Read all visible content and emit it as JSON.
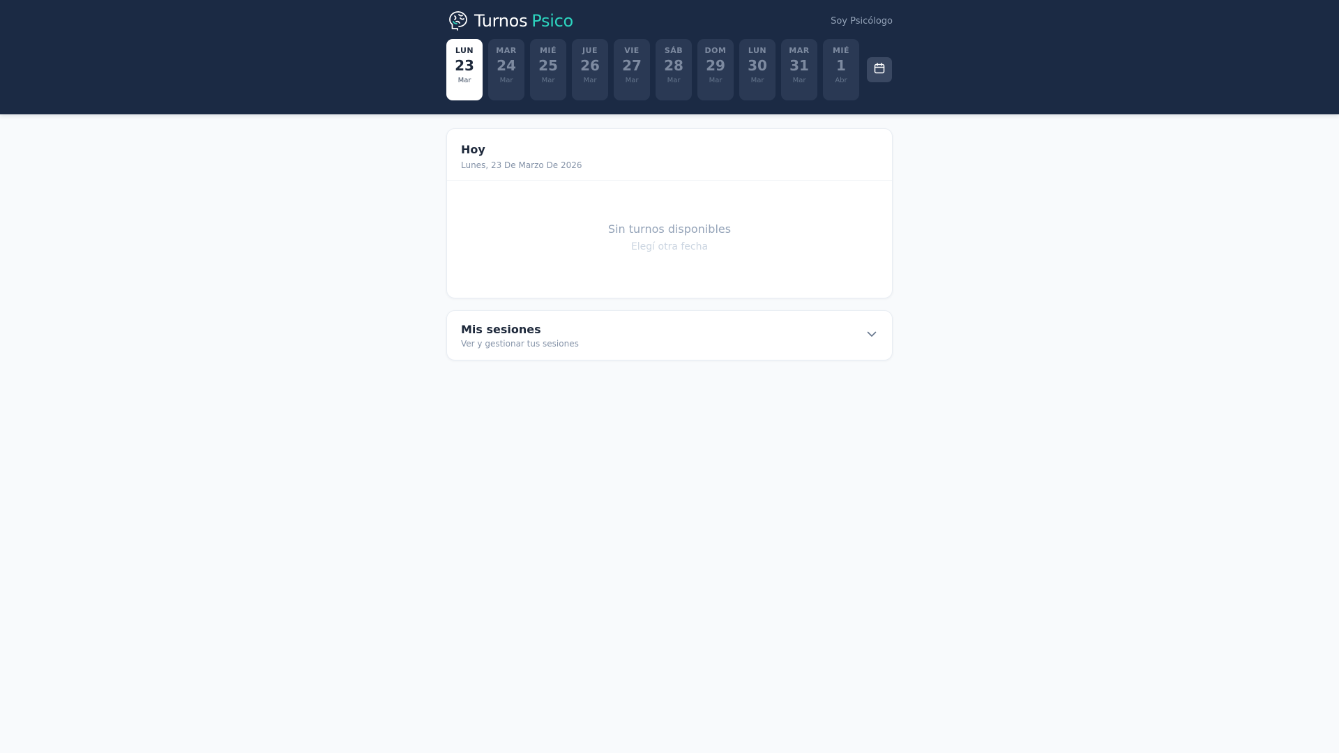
{
  "brand": {
    "name_part1": "Turnos",
    "name_part2": "Psico",
    "logo_icon": "brain-icon",
    "accent_color": "#2dd4bf"
  },
  "header": {
    "psychologist_link": "Soy Psicólogo",
    "calendar_icon": "calendar-icon",
    "background_color": "#1b2a44"
  },
  "days": [
    {
      "dow": "LUN",
      "num": "23",
      "mon": "Mar",
      "selected": true
    },
    {
      "dow": "MAR",
      "num": "24",
      "mon": "Mar",
      "selected": false
    },
    {
      "dow": "MIÉ",
      "num": "25",
      "mon": "Mar",
      "selected": false
    },
    {
      "dow": "JUE",
      "num": "26",
      "mon": "Mar",
      "selected": false
    },
    {
      "dow": "VIE",
      "num": "27",
      "mon": "Mar",
      "selected": false
    },
    {
      "dow": "SÁB",
      "num": "28",
      "mon": "Mar",
      "selected": false
    },
    {
      "dow": "DOM",
      "num": "29",
      "mon": "Mar",
      "selected": false
    },
    {
      "dow": "LUN",
      "num": "30",
      "mon": "Mar",
      "selected": false
    },
    {
      "dow": "MAR",
      "num": "31",
      "mon": "Mar",
      "selected": false
    },
    {
      "dow": "MIÉ",
      "num": "1",
      "mon": "Abr",
      "selected": false
    }
  ],
  "today_card": {
    "title": "Hoy",
    "date": "Lunes, 23 De Marzo De 2026",
    "empty_title": "Sin turnos disponibles",
    "empty_hint": "Elegí otra fecha"
  },
  "sessions_card": {
    "title": "Mis sesiones",
    "subtitle": "Ver y gestionar tus sesiones",
    "toggle_icon": "chevron-down-icon"
  }
}
